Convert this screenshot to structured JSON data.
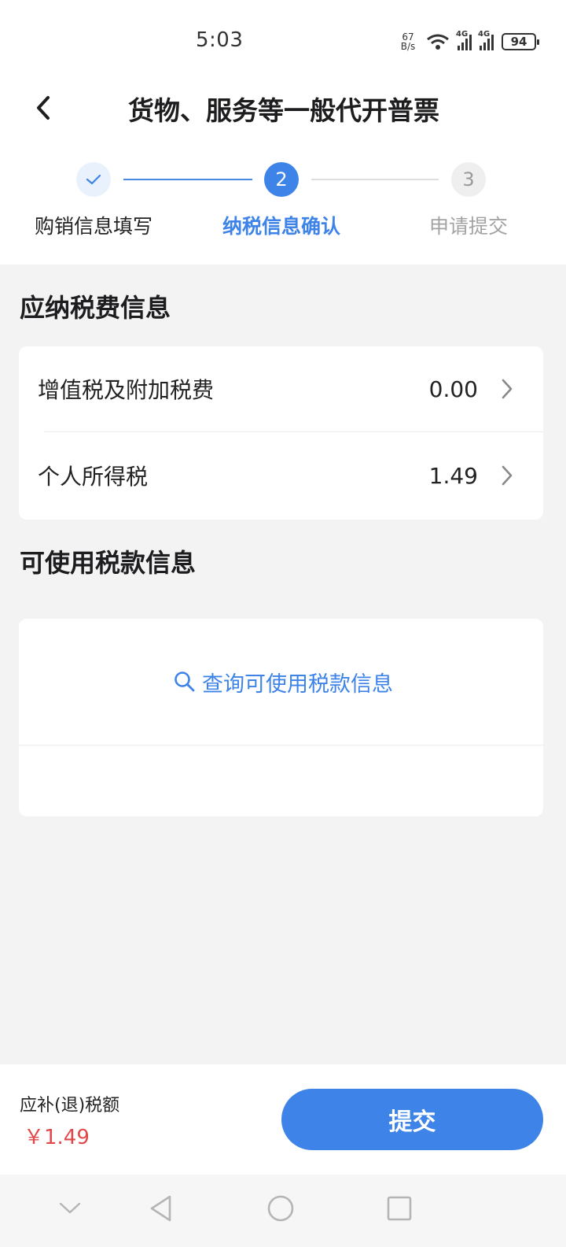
{
  "status_bar": {
    "time": "5:03",
    "net_speed_value": "67",
    "net_speed_unit": "B/s",
    "signal1_label": "4G",
    "signal2_label": "4G",
    "battery": "94"
  },
  "header": {
    "title": "货物、服务等一般代开普票"
  },
  "stepper": {
    "steps": [
      {
        "label": "购销信息填写",
        "number": "",
        "state": "done"
      },
      {
        "label": "纳税信息确认",
        "number": "2",
        "state": "active"
      },
      {
        "label": "申请提交",
        "number": "3",
        "state": "pending"
      }
    ]
  },
  "tax_info": {
    "title": "应纳税费信息",
    "rows": [
      {
        "name": "增值税及附加税费",
        "value": "0.00"
      },
      {
        "name": "个人所得税",
        "value": "1.49"
      }
    ]
  },
  "available_tax": {
    "title": "可使用税款信息",
    "query_label": "查询可使用税款信息"
  },
  "bottom": {
    "amount_label": "应补(退)税额",
    "amount_value": "￥1.49",
    "submit_label": "提交"
  },
  "colors": {
    "accent": "#3d83e8",
    "amount": "#e0484a",
    "background": "#f3f3f4"
  }
}
